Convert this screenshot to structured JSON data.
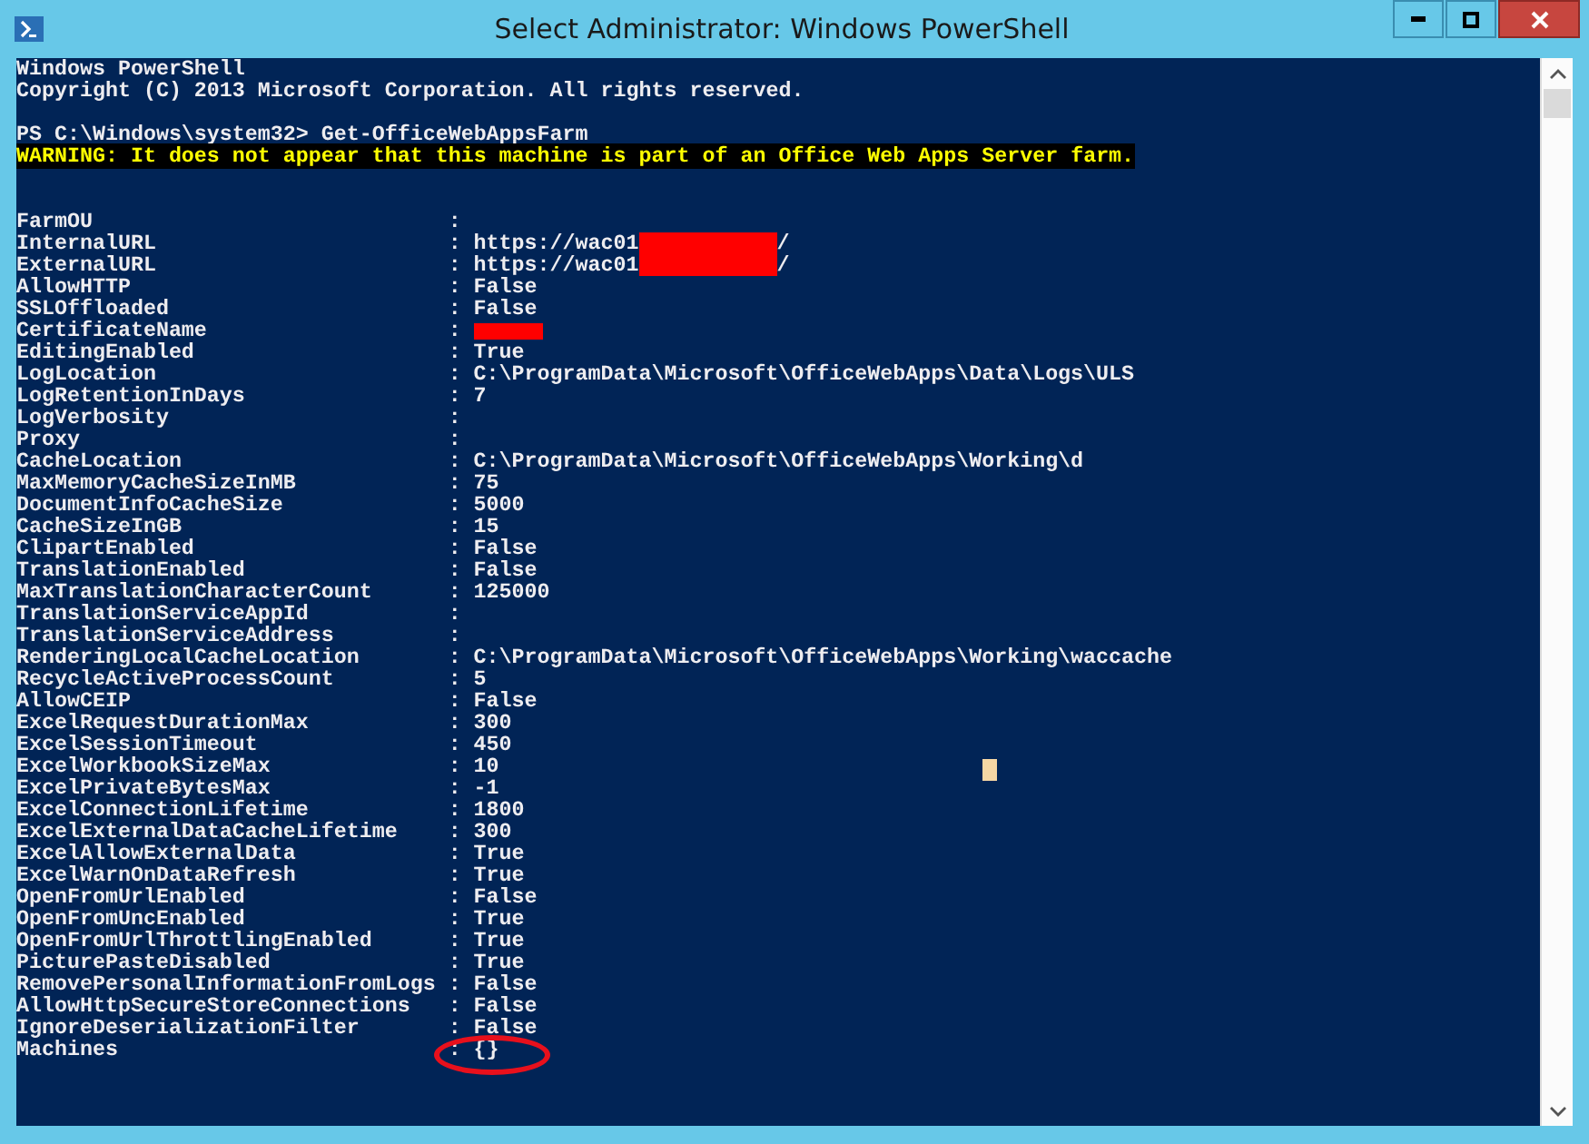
{
  "window": {
    "title": "Select Administrator: Windows PowerShell"
  },
  "console": {
    "header": [
      {
        "kind": "plain",
        "text": "Windows PowerShell"
      },
      {
        "kind": "plain",
        "text": "Copyright (C) 2013 Microsoft Corporation. All rights reserved."
      },
      {
        "kind": "blank"
      },
      {
        "kind": "plain",
        "text": "PS C:\\Windows\\system32> Get-OfficeWebAppsFarm"
      },
      {
        "kind": "warning",
        "text": "WARNING: It does not appear that this machine is part of an Office Web Apps Server farm."
      },
      {
        "kind": "blank"
      },
      {
        "kind": "blank"
      }
    ],
    "properties": [
      {
        "name": "FarmOU",
        "separator": ":"
      },
      {
        "name": "InternalURL",
        "separator": ":",
        "value": [
          {
            "kind": "text",
            "text": "https://wac01"
          },
          {
            "kind": "redaction"
          },
          {
            "kind": "text",
            "text": "/"
          }
        ]
      },
      {
        "name": "ExternalURL",
        "separator": ":",
        "value": [
          {
            "kind": "text",
            "text": "https://wac01"
          },
          {
            "kind": "redaction"
          },
          {
            "kind": "text",
            "text": "/"
          }
        ]
      },
      {
        "name": "AllowHTTP",
        "separator": ":",
        "value": [
          {
            "kind": "text",
            "text": "False"
          }
        ]
      },
      {
        "name": "SSLOffloaded",
        "separator": ":",
        "value": [
          {
            "kind": "text",
            "text": "False"
          }
        ]
      },
      {
        "name": "CertificateName",
        "separator": ":",
        "value": [
          {
            "kind": "redaction-short"
          }
        ]
      },
      {
        "name": "EditingEnabled",
        "separator": ":",
        "value": [
          {
            "kind": "text",
            "text": "True"
          }
        ]
      },
      {
        "name": "LogLocation",
        "separator": ":",
        "value": [
          {
            "kind": "text",
            "text": "C:\\ProgramData\\Microsoft\\OfficeWebApps\\Data\\Logs\\ULS"
          }
        ]
      },
      {
        "name": "LogRetentionInDays",
        "separator": ":",
        "value": [
          {
            "kind": "text",
            "text": "7"
          }
        ]
      },
      {
        "name": "LogVerbosity",
        "separator": ":"
      },
      {
        "name": "Proxy",
        "separator": ":"
      },
      {
        "name": "CacheLocation",
        "separator": ":",
        "value": [
          {
            "kind": "text",
            "text": "C:\\ProgramData\\Microsoft\\OfficeWebApps\\Working\\d"
          }
        ]
      },
      {
        "name": "MaxMemoryCacheSizeInMB",
        "separator": ":",
        "value": [
          {
            "kind": "text",
            "text": "75"
          }
        ]
      },
      {
        "name": "DocumentInfoCacheSize",
        "separator": ":",
        "value": [
          {
            "kind": "text",
            "text": "5000"
          }
        ]
      },
      {
        "name": "CacheSizeInGB",
        "separator": ":",
        "value": [
          {
            "kind": "text",
            "text": "15"
          }
        ]
      },
      {
        "name": "ClipartEnabled",
        "separator": ":",
        "value": [
          {
            "kind": "text",
            "text": "False"
          }
        ]
      },
      {
        "name": "TranslationEnabled",
        "separator": ":",
        "value": [
          {
            "kind": "text",
            "text": "False"
          }
        ]
      },
      {
        "name": "MaxTranslationCharacterCount",
        "separator": ":",
        "value": [
          {
            "kind": "text",
            "text": "125000"
          }
        ]
      },
      {
        "name": "TranslationServiceAppId",
        "separator": ":"
      },
      {
        "name": "TranslationServiceAddress",
        "separator": ":"
      },
      {
        "name": "RenderingLocalCacheLocation",
        "separator": ":",
        "value": [
          {
            "kind": "text",
            "text": "C:\\ProgramData\\Microsoft\\OfficeWebApps\\Working\\waccache"
          }
        ]
      },
      {
        "name": "RecycleActiveProcessCount",
        "separator": ":",
        "value": [
          {
            "kind": "text",
            "text": "5"
          }
        ]
      },
      {
        "name": "AllowCEIP",
        "separator": ":",
        "value": [
          {
            "kind": "text",
            "text": "False"
          }
        ]
      },
      {
        "name": "ExcelRequestDurationMax",
        "separator": ":",
        "value": [
          {
            "kind": "text",
            "text": "300"
          }
        ]
      },
      {
        "name": "ExcelSessionTimeout",
        "separator": ":",
        "value": [
          {
            "kind": "text",
            "text": "450"
          }
        ]
      },
      {
        "name": "ExcelWorkbookSizeMax",
        "separator": ":",
        "value": [
          {
            "kind": "text",
            "text": "10"
          }
        ]
      },
      {
        "name": "ExcelPrivateBytesMax",
        "separator": ":",
        "value": [
          {
            "kind": "text",
            "text": "-1"
          }
        ]
      },
      {
        "name": "ExcelConnectionLifetime",
        "separator": ":",
        "value": [
          {
            "kind": "text",
            "text": "1800"
          }
        ]
      },
      {
        "name": "ExcelExternalDataCacheLifetime",
        "separator": ":",
        "value": [
          {
            "kind": "text",
            "text": "300"
          }
        ]
      },
      {
        "name": "ExcelAllowExternalData",
        "separator": ":",
        "value": [
          {
            "kind": "text",
            "text": "True"
          }
        ]
      },
      {
        "name": "ExcelWarnOnDataRefresh",
        "separator": ":",
        "value": [
          {
            "kind": "text",
            "text": "True"
          }
        ]
      },
      {
        "name": "OpenFromUrlEnabled",
        "separator": ":",
        "value": [
          {
            "kind": "text",
            "text": "False"
          }
        ]
      },
      {
        "name": "OpenFromUncEnabled",
        "separator": ":",
        "value": [
          {
            "kind": "text",
            "text": "True"
          }
        ]
      },
      {
        "name": "OpenFromUrlThrottlingEnabled",
        "separator": ":",
        "value": [
          {
            "kind": "text",
            "text": "True"
          }
        ]
      },
      {
        "name": "PicturePasteDisabled",
        "separator": ":",
        "value": [
          {
            "kind": "text",
            "text": "True"
          }
        ]
      },
      {
        "name": "RemovePersonalInformationFromLogs",
        "separator": ":",
        "value": [
          {
            "kind": "text",
            "text": "False"
          }
        ]
      },
      {
        "name": "AllowHttpSecureStoreConnections",
        "separator": ":",
        "value": [
          {
            "kind": "text",
            "text": "False"
          }
        ]
      },
      {
        "name": "IgnoreDeserializationFilter",
        "separator": ":",
        "value": [
          {
            "kind": "text",
            "text": "False"
          }
        ]
      },
      {
        "name": "Machines",
        "separator": ":",
        "value": [
          {
            "kind": "text",
            "text": "{}"
          }
        ],
        "circled": true
      }
    ]
  }
}
